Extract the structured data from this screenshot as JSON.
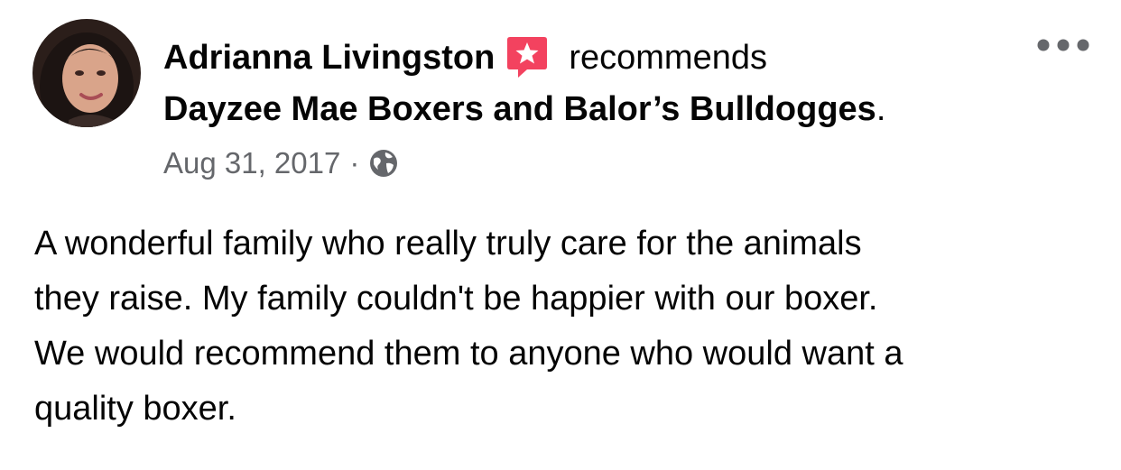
{
  "post": {
    "author_name": "Adrianna Livingston",
    "action_text": "recommends",
    "page_name": "Dayzee Mae Boxers and Balor’s Bulldogges",
    "page_name_suffix": ".",
    "date": "Aug 31, 2017",
    "separator": "·",
    "privacy_icon": "globe-icon",
    "recommend_icon": "recommend-star-icon",
    "more_icon": "more-horizontal-icon",
    "text_lines": [
      "A wonderful family who really truly care for the animals",
      "they raise. My family couldn't be happier with our boxer.",
      "We would recommend them to anyone who would want a",
      "quality boxer."
    ]
  },
  "colors": {
    "text_primary": "#050505",
    "text_secondary": "#65676b",
    "recommend_badge": "#f3425f",
    "background": "#ffffff"
  }
}
